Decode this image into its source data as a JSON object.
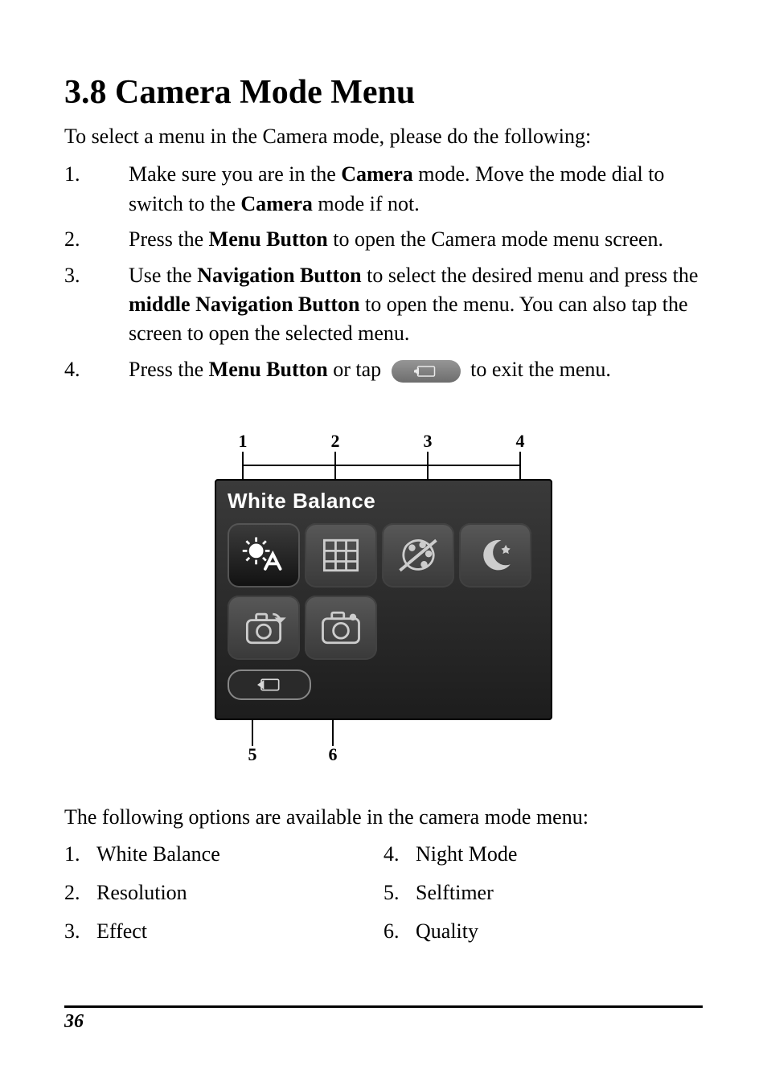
{
  "heading": "3.8 Camera Mode Menu",
  "intro": "To select a menu in the Camera mode, please do the following:",
  "steps": {
    "s1": {
      "pre": "Make sure you are in the ",
      "b1": "Camera",
      "mid": " mode. Move the mode dial to switch to the ",
      "b2": "Camera",
      "post": " mode if not."
    },
    "s2": {
      "pre": "Press the ",
      "b1": "Menu Button",
      "post": " to open the Camera mode menu screen."
    },
    "s3": {
      "pre": "Use the ",
      "b1": "Navigation Button",
      "mid": " to select the desired menu and press the ",
      "b2": "middle Navigation Button",
      "post": " to open the menu. You can also tap the screen to open the selected menu."
    },
    "s4": {
      "pre": "Press the ",
      "b1": "Menu Button",
      "mid": " or tap ",
      "post": " to exit the menu."
    }
  },
  "figure": {
    "screen_title": "White Balance",
    "callouts": {
      "c1": "1",
      "c2": "2",
      "c3": "3",
      "c4": "4",
      "c5": "5",
      "c6": "6"
    }
  },
  "options_intro": "The following options are available in the camera mode menu:",
  "options": {
    "o1": {
      "n": "1.",
      "t": "White Balance"
    },
    "o2": {
      "n": "2.",
      "t": "Resolution"
    },
    "o3": {
      "n": "3.",
      "t": "Effect"
    },
    "o4": {
      "n": "4.",
      "t": "Night Mode"
    },
    "o5": {
      "n": "5.",
      "t": "Selftimer"
    },
    "o6": {
      "n": "6.",
      "t": "Quality"
    }
  },
  "page_number": "36"
}
